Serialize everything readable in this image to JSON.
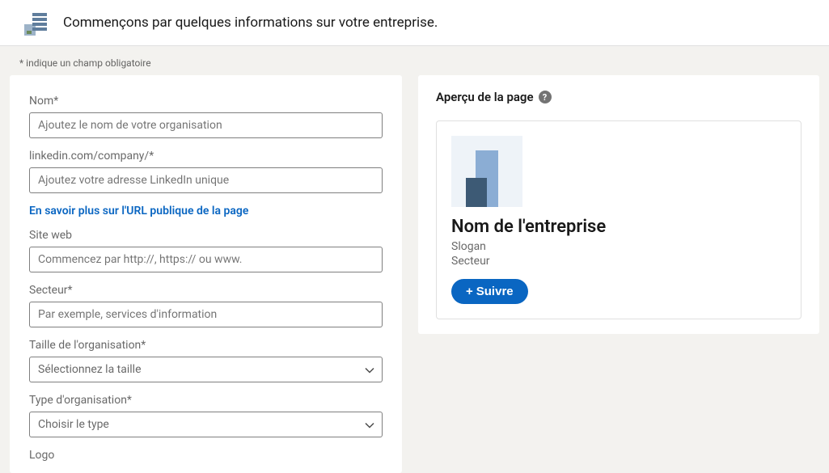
{
  "header": {
    "title": "Commençons par quelques informations sur votre entreprise."
  },
  "requiredNote": "*  indique un champ obligatoire",
  "form": {
    "name": {
      "label": "Nom*",
      "placeholder": "Ajoutez le nom de votre organisation"
    },
    "url": {
      "label": "linkedin.com/company/*",
      "placeholder": "Ajoutez votre adresse LinkedIn unique"
    },
    "urlHelpLink": "En savoir plus sur l'URL publique de la page",
    "website": {
      "label": "Site web",
      "placeholder": "Commencez par http://, https:// ou www."
    },
    "sector": {
      "label": "Secteur*",
      "placeholder": "Par exemple, services d'information"
    },
    "size": {
      "label": "Taille de l'organisation*",
      "placeholder": "Sélectionnez la taille"
    },
    "orgType": {
      "label": "Type d'organisation*",
      "placeholder": "Choisir le type"
    },
    "logo": {
      "label": "Logo"
    }
  },
  "preview": {
    "heading": "Aperçu de la page",
    "companyName": "Nom de l'entreprise",
    "slogan": "Slogan",
    "sector": "Secteur",
    "followButton": "Suivre"
  },
  "colors": {
    "accent": "#0a66c2",
    "link": "#0a66c2"
  }
}
